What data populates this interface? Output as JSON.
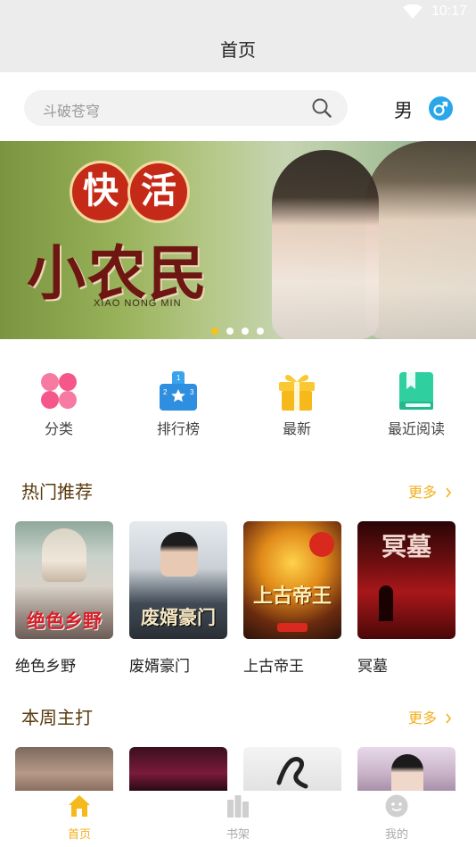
{
  "status_bar": {
    "time": "10:17"
  },
  "header": {
    "title": "首页"
  },
  "search": {
    "placeholder": "斗破苍穹",
    "gender_label": "男"
  },
  "banner": {
    "title_chars": [
      "快",
      "活"
    ],
    "big_text": "小农民",
    "pinyin": "XIAO NONG MIN",
    "slide_count": 4,
    "active_slide": 1
  },
  "quick_nav": [
    {
      "label": "分类",
      "icon": "category-grid-icon",
      "color": "#f05f8a"
    },
    {
      "label": "排行榜",
      "icon": "ranking-podium-icon",
      "color": "#2e9ae8"
    },
    {
      "label": "最新",
      "icon": "gift-icon",
      "color": "#f6c21b"
    },
    {
      "label": "最近阅读",
      "icon": "bookmark-book-icon",
      "color": "#2fcfa0"
    }
  ],
  "sections": {
    "hot": {
      "title": "热门推荐",
      "more": "更多",
      "books": [
        {
          "title": "绝色乡野",
          "cover_text": "绝色乡野"
        },
        {
          "title": "废婿豪门",
          "cover_text": "废婿豪门"
        },
        {
          "title": "上古帝王",
          "cover_text": "上古帝王"
        },
        {
          "title": "冥墓",
          "cover_text": "冥墓"
        }
      ]
    },
    "weekly": {
      "title": "本周主打",
      "more": "更多"
    }
  },
  "tabs": [
    {
      "label": "首页",
      "icon": "home-icon",
      "active": true
    },
    {
      "label": "书架",
      "icon": "bookshelf-icon",
      "active": false
    },
    {
      "label": "我的",
      "icon": "profile-icon",
      "active": false
    }
  ],
  "colors": {
    "accent": "#f2b01e",
    "section_title": "#5a3a0d",
    "header_bg": "#ececec"
  }
}
